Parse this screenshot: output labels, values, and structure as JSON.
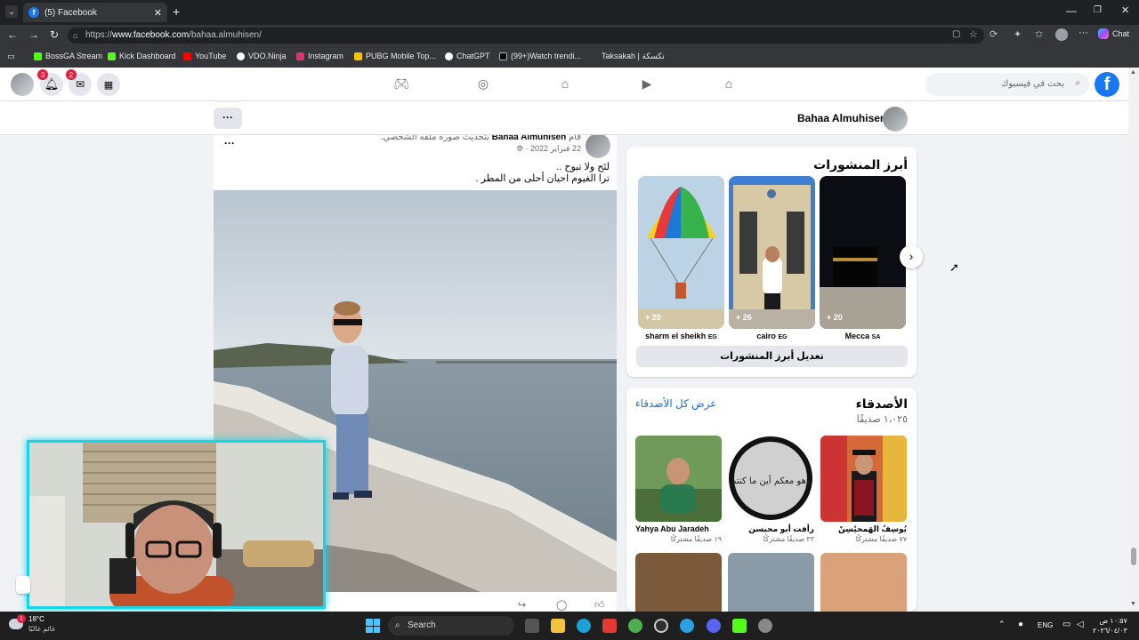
{
  "browser": {
    "tab_title": "(5) Facebook",
    "url_prefix": "https://",
    "url_domain": "www.facebook.com",
    "url_path": "/bahaa.almuhisen/",
    "chat_label": "Chat"
  },
  "bookmarks": [
    {
      "label": "BossGA Stream",
      "color": "#53fc18"
    },
    {
      "label": "Kick Dashboard",
      "color": "#53fc18"
    },
    {
      "label": "YouTube",
      "color": "#ff0000"
    },
    {
      "label": "VDO.Ninja",
      "color": "#ffffff"
    },
    {
      "label": "Instagram",
      "color": "#e1306c"
    },
    {
      "label": "PUBG Mobile Top...",
      "color": "#f7c600"
    },
    {
      "label": "ChatGPT",
      "color": "#ffffff"
    },
    {
      "label": "(99+)Watch trendi...",
      "color": "#000000"
    },
    {
      "label": "Taksakah | تكسكة",
      "color": "#888888"
    }
  ],
  "fbbar": {
    "notif_badge": "3",
    "messenger_badge": "2",
    "search_placeholder": "بحث في فيسبوك",
    "logo": "f"
  },
  "profile": {
    "name": "Bahaa Almuhisen",
    "more": "···"
  },
  "post": {
    "author": "Bahaa Almuhisen",
    "verb_prefix": "قام",
    "action": "بتحديث صورة ملفه الشخصي.",
    "date": "22 فبراير 2022 ·",
    "line1": "لتَح ولا تبوح ..",
    "line2": "ترا الغيوم احيان أحلى من المطر .",
    "more": "···"
  },
  "highlights": {
    "title": "أبرز المنشورات",
    "edit_button": "تعديل أبرز المنشورات",
    "items": [
      {
        "label": "sharm el sheikh",
        "cc": "EG",
        "count": "+ 20"
      },
      {
        "label": "cairo",
        "cc": "EG",
        "count": "+ 26"
      },
      {
        "label": "Mecca",
        "cc": "SA",
        "count": "+ 20"
      }
    ]
  },
  "friends": {
    "title": "الأصدقاء",
    "count": "١،٠٢٥ صديقًا",
    "see_all": "عرض كل الأصدقاء",
    "items": [
      {
        "name": "Yahya Abu Jaradeh",
        "mutual": "١٩ صديقًا مشتركًا"
      },
      {
        "name": "رأفت أبو محيسن",
        "mutual": "٣٣ صديقًا مشتركًا"
      },
      {
        "name": "يُوسِفُ الهَمحيْسِنْ",
        "mutual": "٧٧ صديقًا مشتركًا"
      }
    ],
    "frame_text": "وهو معكم أين ما كنتم"
  },
  "taskbar": {
    "temp": "18°C",
    "weather": "غائم غالبًا",
    "search": "Search",
    "lang": "ENG",
    "time": "١٠:٥٧ ص",
    "date": "٢٠٢٦/٠٤/٠٣",
    "weather_badge": "1"
  }
}
